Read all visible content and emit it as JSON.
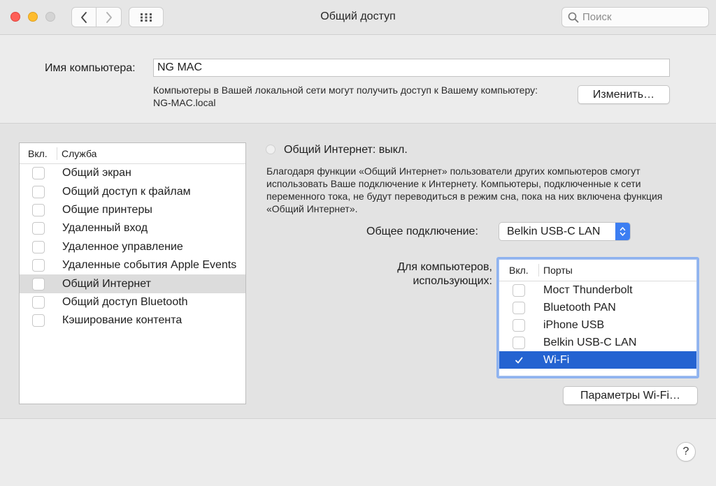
{
  "window": {
    "title": "Общий доступ",
    "search_placeholder": "Поиск"
  },
  "computer_name": {
    "label": "Имя компьютера:",
    "value": "NG MAC",
    "description": "Компьютеры в Вашей локальной сети могут получить доступ к Вашему компьютеру: NG-MAC.local",
    "edit_button": "Изменить…"
  },
  "services": {
    "header_on": "Вкл.",
    "header_service": "Служба",
    "items": [
      {
        "label": "Общий экран",
        "checked": false
      },
      {
        "label": "Общий доступ к файлам",
        "checked": false
      },
      {
        "label": "Общие принтеры",
        "checked": false
      },
      {
        "label": "Удаленный вход",
        "checked": false
      },
      {
        "label": "Удаленное управление",
        "checked": false
      },
      {
        "label": "Удаленные события Apple Events",
        "checked": false
      },
      {
        "label": "Общий Интернет",
        "checked": false,
        "selected": true
      },
      {
        "label": "Общий доступ Bluetooth",
        "checked": false
      },
      {
        "label": "Кэширование контента",
        "checked": false
      }
    ]
  },
  "internet_sharing": {
    "status": "Общий Интернет: выкл.",
    "description": "Благодаря функции «Общий Интернет» пользователи других компьютеров смогут использовать Ваше подключение к Интернету. Компьютеры, подключенные к сети переменного тока, не будут переводиться в режим сна, пока на них включена функция «Общий Интернет».",
    "share_from_label": "Общее подключение:",
    "share_from_value": "Belkin USB-C LAN",
    "to_computers_label": "Для компьютеров, использующих:",
    "ports_header_on": "Вкл.",
    "ports_header_ports": "Порты",
    "ports": [
      {
        "label": "Мост Thunderbolt",
        "checked": false
      },
      {
        "label": "Bluetooth PAN",
        "checked": false
      },
      {
        "label": "iPhone USB",
        "checked": false
      },
      {
        "label": "Belkin USB-C LAN",
        "checked": false
      },
      {
        "label": "Wi-Fi",
        "checked": true,
        "selected": true
      }
    ],
    "wifi_options_button": "Параметры Wi-Fi…"
  },
  "help_button": "?",
  "colors": {
    "accent": "#2463d1",
    "close": "#fe5f57",
    "minimize": "#febc2e",
    "focus_ring": "#8fb3ef"
  }
}
